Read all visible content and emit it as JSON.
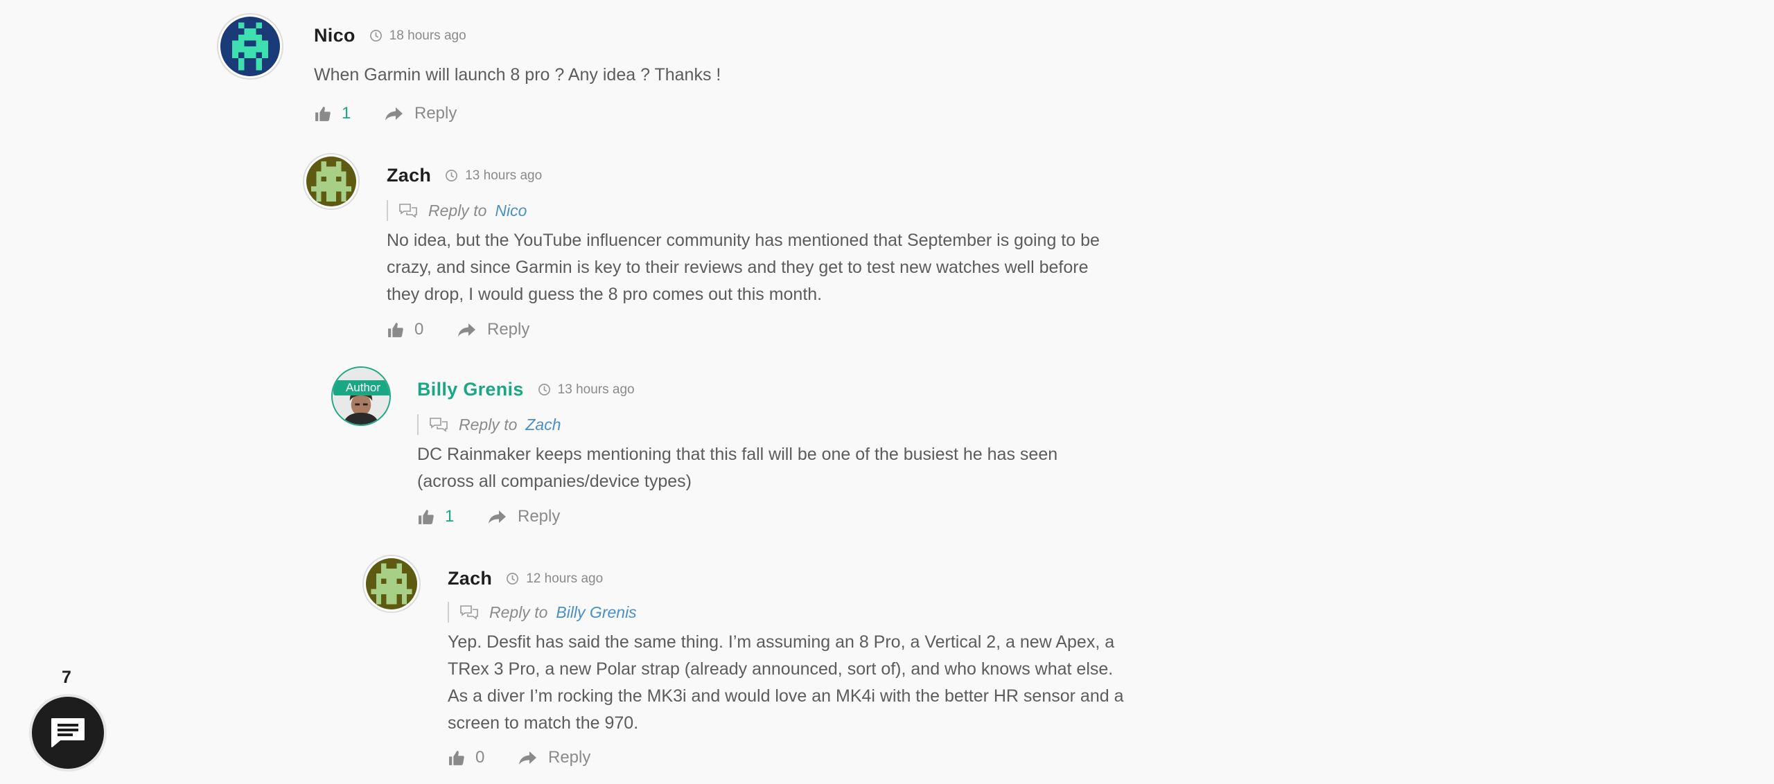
{
  "comments": [
    {
      "author": "Nico",
      "time": "18 hours ago",
      "reply_to_label": "",
      "reply_to": "",
      "text": "When Garmin will launch 8 pro ? Any idea ? Thanks !",
      "likes": "1",
      "reply_label": "Reply",
      "is_author": false,
      "avatar": "pixel-avatar-navy"
    },
    {
      "author": "Zach",
      "time": "13 hours ago",
      "reply_to_label": "Reply to",
      "reply_to": "Nico",
      "text": "No idea, but the YouTube influencer community has mentioned that September is going to be crazy, and since Garmin is key to their reviews and they get to test new watches well before they drop, I would guess the 8 pro comes out this month.",
      "likes": "0",
      "reply_label": "Reply",
      "is_author": false,
      "avatar": "pixel-avatar-olive"
    },
    {
      "author": "Billy Grenis",
      "badge": "Author",
      "time": "13 hours ago",
      "reply_to_label": "Reply to",
      "reply_to": "Zach",
      "text": "DC Rainmaker keeps mentioning that this fall will be one of the busiest he has seen (across all companies/device types)",
      "likes": "1",
      "reply_label": "Reply",
      "is_author": true,
      "avatar": "photo-avatar"
    },
    {
      "author": "Zach",
      "time": "12 hours ago",
      "reply_to_label": "Reply to",
      "reply_to": "Billy Grenis",
      "text": "Yep. Desfit has said the same thing. I’m assuming an 8 Pro, a Vertical 2, a new Apex, a TRex 3 Pro, a new Polar strap (already announced, sort of), and who knows what else. As a diver I’m rocking the MK3i and would love an MK4i with the better HR sensor and a screen to match the 970.",
      "likes": "0",
      "reply_label": "Reply",
      "is_author": false,
      "avatar": "pixel-avatar-olive"
    }
  ],
  "comments_button": {
    "count": "7",
    "icon": "comments-icon"
  },
  "colors": {
    "background": "#f9f9f9",
    "author_accent": "#1aa884",
    "link": "#4a90c7",
    "avatar_navy": "#1a3a78",
    "avatar_teal": "#3fe0b0",
    "avatar_olive": "#5e5a12",
    "avatar_olive_fg": "#a8cf86"
  }
}
